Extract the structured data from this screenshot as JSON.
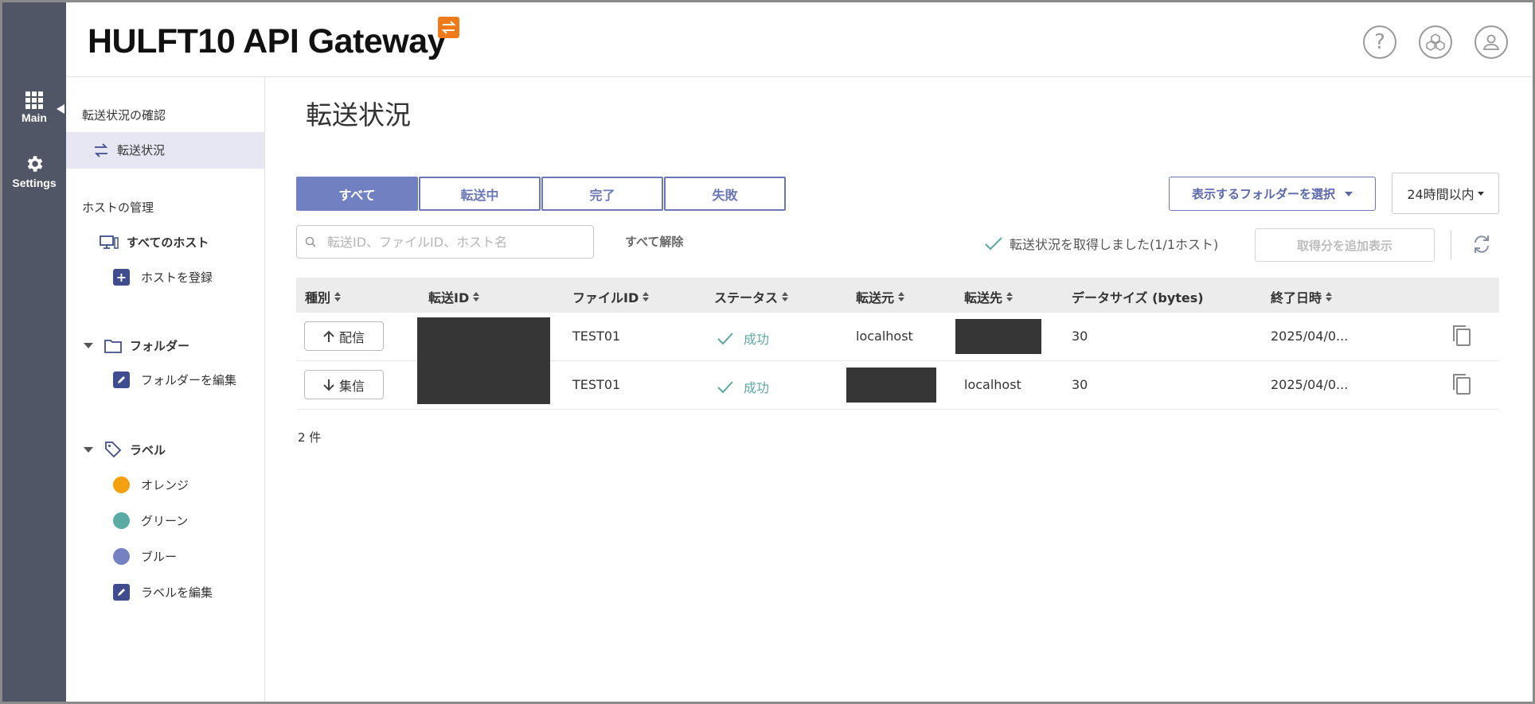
{
  "app": {
    "title": "HULFT10 API Gateway"
  },
  "rail": {
    "main_label": "Main",
    "settings_label": "Settings"
  },
  "sidebar": {
    "section_transfer": "転送状況の確認",
    "transfer_status": "転送状況",
    "section_hosts": "ホストの管理",
    "all_hosts": "すべてのホスト",
    "register_host": "ホストを登録",
    "folders": "フォルダー",
    "edit_folders": "フォルダーを編集",
    "labels": "ラベル",
    "label_items": [
      {
        "name": "オレンジ",
        "color": "#f5a00f"
      },
      {
        "name": "グリーン",
        "color": "#59aba4"
      },
      {
        "name": "ブルー",
        "color": "#7581c0"
      }
    ],
    "edit_labels": "ラベルを編集"
  },
  "main": {
    "page_title": "転送状況",
    "filter_tabs": [
      "すべて",
      "転送中",
      "完了",
      "失敗"
    ],
    "active_tab": "すべて",
    "folder_select": "表示するフォルダーを選択",
    "time_select": "24時間以内",
    "search_placeholder": "転送ID、ファイルID、ホスト名",
    "clear_all": "すべて解除",
    "status_message": "転送状況を取得しました(1/1ホスト)",
    "load_more": "取得分を追加表示",
    "count": "2 件"
  },
  "table": {
    "headers": [
      "種別",
      "転送ID",
      "ファイルID",
      "ステータス",
      "転送元",
      "転送先",
      "データサイズ (bytes)",
      "終了日時"
    ],
    "rows": [
      {
        "type": "配信",
        "direction": "up",
        "file_id": "TEST01",
        "status": "成功",
        "source": "localhost",
        "destination": "",
        "size": "30",
        "end": "2025/04/0..."
      },
      {
        "type": "集信",
        "direction": "down",
        "file_id": "TEST01",
        "status": "成功",
        "source": "",
        "destination": "localhost",
        "size": "30",
        "end": "2025/04/0..."
      }
    ]
  },
  "colors": {
    "accent": "#6b78b8",
    "rail": "#505665",
    "success": "#5aa9a2",
    "logo": "#f07a1a"
  }
}
